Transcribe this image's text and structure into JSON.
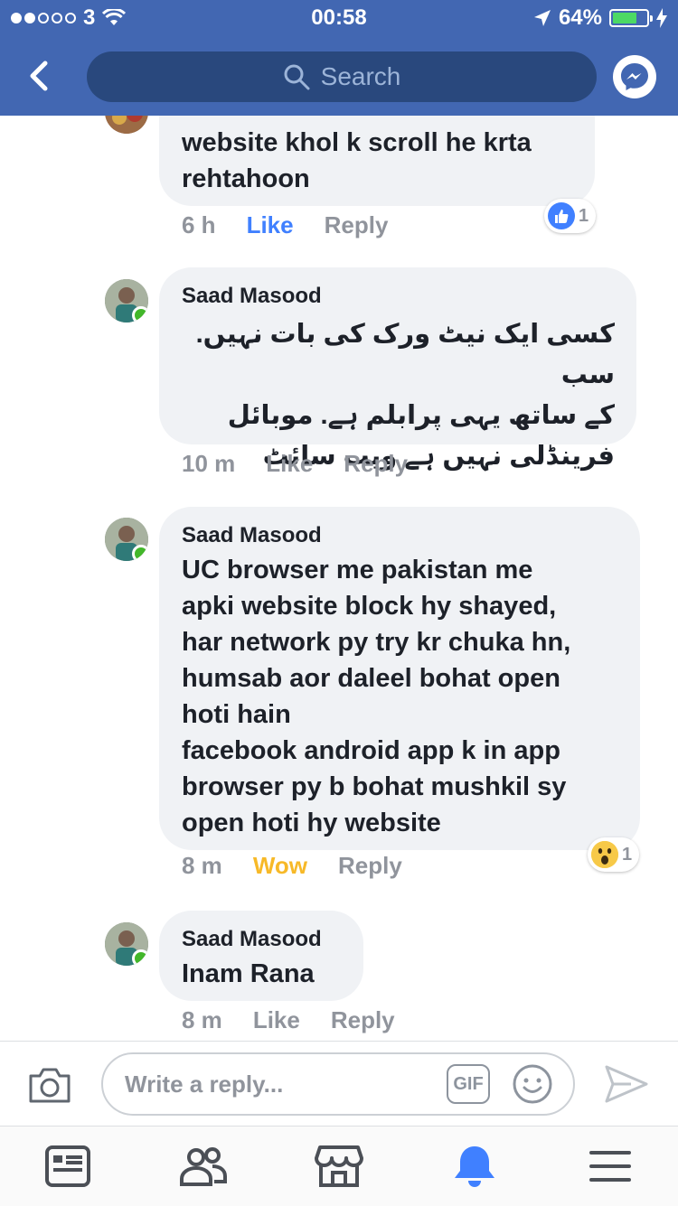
{
  "status_bar": {
    "carrier": "3",
    "time": "00:58",
    "battery": "64%",
    "signal_bars_filled": 2,
    "signal_bars_total": 5,
    "battery_level": 0.64
  },
  "header": {
    "search_placeholder": "Search"
  },
  "comments": [
    {
      "author": "",
      "text_lines": [
        "website khol k scroll he krta",
        "rehtahoon"
      ],
      "time": "6 h",
      "action_label": "Like",
      "reply_label": "Reply",
      "reaction": "like",
      "reaction_count": "1"
    },
    {
      "author": "Saad Masood",
      "text_lines": [
        "کسی ایک نیٹ ورک کی بات نہیں. سب",
        "کے ساتھ یہی پرابلم ہے. موبائل",
        "فرینڈلی نہیں ہے ویب سائٹ"
      ],
      "time": "10 m",
      "action_label": "Like",
      "reply_label": "Reply"
    },
    {
      "author": "Saad Masood",
      "text_lines": [
        "UC browser me pakistan me",
        "apki website block hy shayed,",
        "har network py try kr chuka hn,",
        "humsab aor daleel bohat open",
        "hoti hain",
        "facebook android app k in app",
        "browser py b bohat mushkil sy",
        "open hoti hy website"
      ],
      "time": "8 m",
      "action_label": "Wow",
      "reply_label": "Reply",
      "reaction": "wow",
      "reaction_count": "1"
    },
    {
      "author": "Saad Masood",
      "text_lines": [
        "Inam Rana"
      ],
      "time": "8 m",
      "action_label": "Like",
      "reply_label": "Reply"
    }
  ],
  "composer": {
    "placeholder": "Write a reply...",
    "gif_label": "GIF"
  },
  "bottom_nav": {
    "items": [
      "news-feed-icon",
      "friends-icon",
      "marketplace-icon",
      "notifications-icon",
      "menu-icon"
    ],
    "active": "notifications-icon"
  },
  "colors": {
    "header_blue": "#4267b2",
    "search_blue": "#29487d",
    "link_blue": "#4080ff",
    "wow_yellow": "#f7b928",
    "bubble_grey": "#f0f2f5",
    "online_green": "#42b72a"
  }
}
